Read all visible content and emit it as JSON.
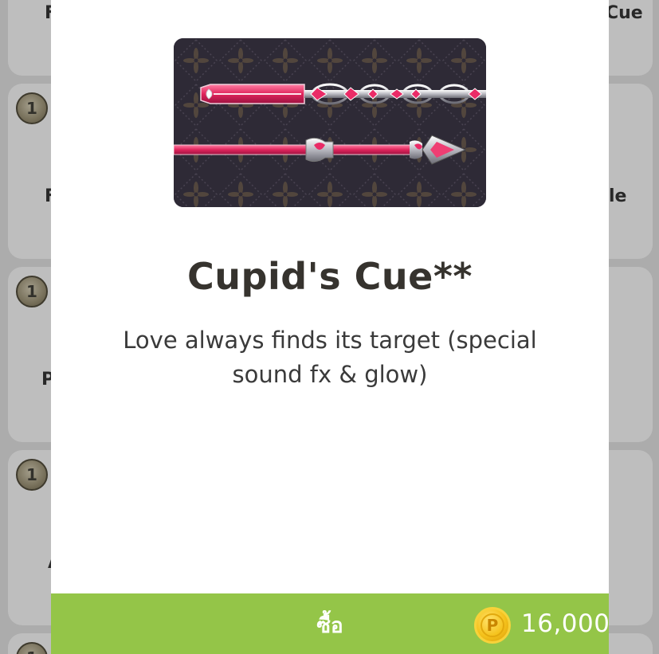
{
  "background": {
    "cards": [
      {
        "side": "left",
        "text": "F"
      },
      {
        "side": "right",
        "text": "Cue"
      },
      {
        "side": "left",
        "text": "F"
      },
      {
        "side": "right",
        "text": "le"
      },
      {
        "side": "left",
        "text": "P"
      },
      {
        "side": "left",
        "text": "A"
      }
    ],
    "badge_label": "1"
  },
  "item": {
    "name": "Cupid's Cue**",
    "description": "Love always finds its target (special sound fx & glow)"
  },
  "buy_bar": {
    "label": "ซื้อ",
    "coin_icon": "P",
    "price": "16,000"
  },
  "colors": {
    "buy_bar": "#94c548",
    "coin": "#f5c21c",
    "title": "#36332e",
    "preview_bg": "#2e2a36",
    "cue_pink": "#e23c6e"
  }
}
